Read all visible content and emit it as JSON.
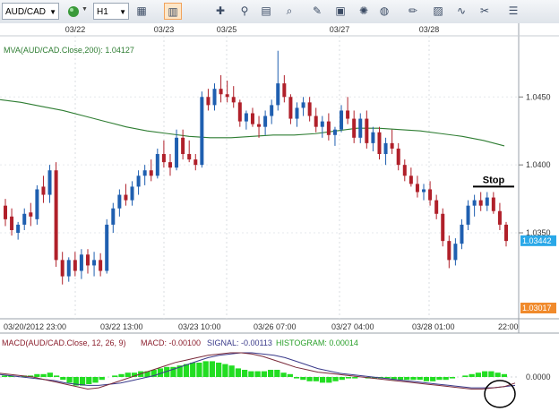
{
  "toolbar": {
    "symbol": "AUD/CAD",
    "timeframe": "H1",
    "icons": [
      "globe-icon",
      "bar-chart-icon",
      "candlestick-icon",
      "line-chart-icon",
      "crosshair-icon",
      "zoom-icon",
      "drawing-icon",
      "notes-icon",
      "grid-icon",
      "globe-icon",
      "pencil-icon",
      "image-icon",
      "studies-icon",
      "scissors-icon",
      "menu-icon"
    ]
  },
  "colors": {
    "bull": "#1f5fb0",
    "bear": "#b0202a",
    "ma": "#2e7d32",
    "macd": "#7a2a3a",
    "signal": "#3a3a8a",
    "hist": "#22dd22",
    "price_badge": "#2aa8e8",
    "low_badge": "#f08a2c"
  },
  "top_dates": [
    "03/22",
    "03/23",
    "03/25",
    "03/27",
    "03/28"
  ],
  "ma_label": "MVA(AUD/CAD.Close,200): 1.04127",
  "price_axis": [
    "1.0450",
    "1.0400",
    "1.0350"
  ],
  "current_price": "1.03442",
  "low_price": "1.03017",
  "bottom_times": [
    "03/20/2012 23:00",
    "03/22 13:00",
    "03/23 10:00",
    "03/26 07:00",
    "03/27 04:00",
    "03/28 01:00",
    "22:00"
  ],
  "stop_label": "Stop",
  "macd": {
    "title": "MACD(AUD/CAD.Close, 12, 26, 9)",
    "macd_text": "MACD: -0.00100",
    "signal_text": "SIGNAL: -0.00113",
    "hist_text": "HISTOGRAM: 0.00014",
    "axis": "0.0000"
  },
  "chart_data": {
    "type": "candlestick",
    "y_unit": "AUD/CAD",
    "ylim": [
      1.0294,
      1.0495
    ],
    "candles": [
      [
        1.037,
        1.0375,
        1.0355,
        1.036
      ],
      [
        1.0362,
        1.0368,
        1.0348,
        1.0352
      ],
      [
        1.035,
        1.0358,
        1.0345,
        1.0356
      ],
      [
        1.0356,
        1.0368,
        1.0352,
        1.0364
      ],
      [
        1.0365,
        1.0372,
        1.0355,
        1.0362
      ],
      [
        1.036,
        1.0385,
        1.0356,
        1.0382
      ],
      [
        1.0384,
        1.0392,
        1.0372,
        1.0378
      ],
      [
        1.0378,
        1.04,
        1.0372,
        1.0396
      ],
      [
        1.0396,
        1.0402,
        1.0325,
        1.033
      ],
      [
        1.033,
        1.0336,
        1.0312,
        1.0318
      ],
      [
        1.0318,
        1.0332,
        1.0314,
        1.033
      ],
      [
        1.033,
        1.0336,
        1.0318,
        1.0322
      ],
      [
        1.0322,
        1.0338,
        1.0316,
        1.0334
      ],
      [
        1.0334,
        1.0338,
        1.032,
        1.0326
      ],
      [
        1.0326,
        1.0336,
        1.0318,
        1.033
      ],
      [
        1.033,
        1.0335,
        1.0318,
        1.0322
      ],
      [
        1.0322,
        1.036,
        1.032,
        1.0356
      ],
      [
        1.0356,
        1.0372,
        1.035,
        1.0368
      ],
      [
        1.0368,
        1.0382,
        1.0362,
        1.0378
      ],
      [
        1.0378,
        1.0386,
        1.037,
        1.0374
      ],
      [
        1.0374,
        1.0388,
        1.037,
        1.0384
      ],
      [
        1.0384,
        1.0396,
        1.0378,
        1.0392
      ],
      [
        1.0392,
        1.04,
        1.0385,
        1.0396
      ],
      [
        1.0396,
        1.0404,
        1.0388,
        1.0392
      ],
      [
        1.0392,
        1.0412,
        1.039,
        1.0408
      ],
      [
        1.0408,
        1.0418,
        1.0398,
        1.0402
      ],
      [
        1.0402,
        1.0408,
        1.0392,
        1.0398
      ],
      [
        1.0398,
        1.0426,
        1.0396,
        1.042
      ],
      [
        1.042,
        1.0426,
        1.0404,
        1.0408
      ],
      [
        1.0408,
        1.0418,
        1.0402,
        1.0404
      ],
      [
        1.0404,
        1.0408,
        1.0396,
        1.04
      ],
      [
        1.04,
        1.0454,
        1.0398,
        1.045
      ],
      [
        1.045,
        1.0456,
        1.044,
        1.0444
      ],
      [
        1.0444,
        1.046,
        1.044,
        1.0456
      ],
      [
        1.0456,
        1.0466,
        1.0446,
        1.0452
      ],
      [
        1.0452,
        1.0462,
        1.0446,
        1.045
      ],
      [
        1.045,
        1.0458,
        1.0442,
        1.0446
      ],
      [
        1.0446,
        1.0448,
        1.0428,
        1.0432
      ],
      [
        1.0432,
        1.044,
        1.0426,
        1.0438
      ],
      [
        1.0438,
        1.0442,
        1.0428,
        1.043
      ],
      [
        1.043,
        1.0436,
        1.042,
        1.0428
      ],
      [
        1.0428,
        1.044,
        1.0422,
        1.0436
      ],
      [
        1.0436,
        1.0448,
        1.043,
        1.0444
      ],
      [
        1.0444,
        1.0484,
        1.044,
        1.046
      ],
      [
        1.046,
        1.0466,
        1.0446,
        1.045
      ],
      [
        1.045,
        1.0452,
        1.043,
        1.0434
      ],
      [
        1.0434,
        1.0446,
        1.0428,
        1.0442
      ],
      [
        1.0442,
        1.045,
        1.0436,
        1.0446
      ],
      [
        1.0446,
        1.045,
        1.0432,
        1.0436
      ],
      [
        1.0436,
        1.0442,
        1.0424,
        1.0428
      ],
      [
        1.0428,
        1.0436,
        1.042,
        1.0432
      ],
      [
        1.0432,
        1.0438,
        1.0418,
        1.0422
      ],
      [
        1.0422,
        1.0428,
        1.0414,
        1.0426
      ],
      [
        1.0426,
        1.0444,
        1.0424,
        1.044
      ],
      [
        1.044,
        1.045,
        1.043,
        1.0434
      ],
      [
        1.0434,
        1.044,
        1.0416,
        1.042
      ],
      [
        1.042,
        1.0438,
        1.0416,
        1.0434
      ],
      [
        1.0434,
        1.044,
        1.0412,
        1.0416
      ],
      [
        1.0416,
        1.0428,
        1.041,
        1.0424
      ],
      [
        1.0424,
        1.0428,
        1.0404,
        1.0408
      ],
      [
        1.0408,
        1.042,
        1.04,
        1.0416
      ],
      [
        1.0416,
        1.0426,
        1.0408,
        1.0412
      ],
      [
        1.0412,
        1.0416,
        1.0396,
        1.04
      ],
      [
        1.04,
        1.0404,
        1.0388,
        1.0392
      ],
      [
        1.0392,
        1.0398,
        1.0384,
        1.0386
      ],
      [
        1.0386,
        1.0392,
        1.0376,
        1.038
      ],
      [
        1.038,
        1.0386,
        1.0374,
        1.0382
      ],
      [
        1.0382,
        1.0388,
        1.037,
        1.0374
      ],
      [
        1.0374,
        1.0378,
        1.036,
        1.0364
      ],
      [
        1.0364,
        1.0368,
        1.034,
        1.0344
      ],
      [
        1.0344,
        1.0348,
        1.0324,
        1.033
      ],
      [
        1.033,
        1.0346,
        1.0326,
        1.0342
      ],
      [
        1.0342,
        1.036,
        1.0338,
        1.0356
      ],
      [
        1.0356,
        1.0374,
        1.0352,
        1.037
      ],
      [
        1.037,
        1.0378,
        1.0362,
        1.0374
      ],
      [
        1.0374,
        1.038,
        1.0366,
        1.037
      ],
      [
        1.037,
        1.038,
        1.0366,
        1.0376
      ],
      [
        1.0376,
        1.038,
        1.0364,
        1.0366
      ],
      [
        1.0366,
        1.0372,
        1.0352,
        1.0356
      ],
      [
        1.0356,
        1.0358,
        1.034,
        1.0344
      ]
    ],
    "ma_200": [
      1.0448,
      1.0446,
      1.0443,
      1.044,
      1.0436,
      1.0432,
      1.0428,
      1.0425,
      1.0423,
      1.0421,
      1.042,
      1.042,
      1.0421,
      1.0422,
      1.0422,
      1.0423,
      1.0425,
      1.0427,
      1.0427,
      1.0426,
      1.0425,
      1.0423,
      1.0421,
      1.0418,
      1.0414
    ],
    "stop_level": 1.0384,
    "macd_hist": [
      1,
      1,
      0,
      1,
      1,
      2,
      2,
      3,
      1,
      -2,
      -4,
      -6,
      -6,
      -5,
      -4,
      -2,
      0,
      1,
      2,
      3,
      3,
      4,
      4,
      5,
      6,
      7,
      7,
      8,
      9,
      10,
      10,
      11,
      11,
      10,
      9,
      8,
      6,
      5,
      4,
      4,
      4,
      5,
      5,
      3,
      2,
      -1,
      -2,
      -3,
      -3,
      -4,
      -4,
      -3,
      -2,
      -1,
      -1,
      0,
      -1,
      -1,
      -1,
      -1,
      -2,
      -2,
      -2,
      -2,
      -2,
      -3,
      -3,
      -2,
      -2,
      -1,
      0,
      1,
      2,
      3,
      4,
      4,
      3,
      2
    ],
    "macd_line": [
      3,
      2,
      1,
      0,
      -2,
      -4,
      -6,
      -8,
      -10,
      -9,
      -6,
      -3,
      0,
      3,
      6,
      9,
      12,
      14,
      16,
      18,
      19,
      20,
      20,
      19,
      17,
      14,
      11,
      8,
      6,
      4,
      3,
      2,
      1,
      0,
      -1,
      -2,
      -3,
      -4,
      -5,
      -6,
      -7,
      -8,
      -9,
      -10,
      -10,
      -9,
      -8,
      -5
    ],
    "signal_line": [
      2,
      1,
      0,
      -1,
      -2,
      -3,
      -5,
      -6,
      -7,
      -7,
      -6,
      -5,
      -3,
      -1,
      1,
      4,
      7,
      10,
      13,
      16,
      18,
      19,
      20,
      20,
      19,
      18,
      16,
      13,
      10,
      7,
      5,
      3,
      2,
      1,
      0,
      -1,
      -2,
      -3,
      -4,
      -5,
      -6,
      -7,
      -8,
      -9,
      -9,
      -9,
      -8,
      -7
    ]
  }
}
